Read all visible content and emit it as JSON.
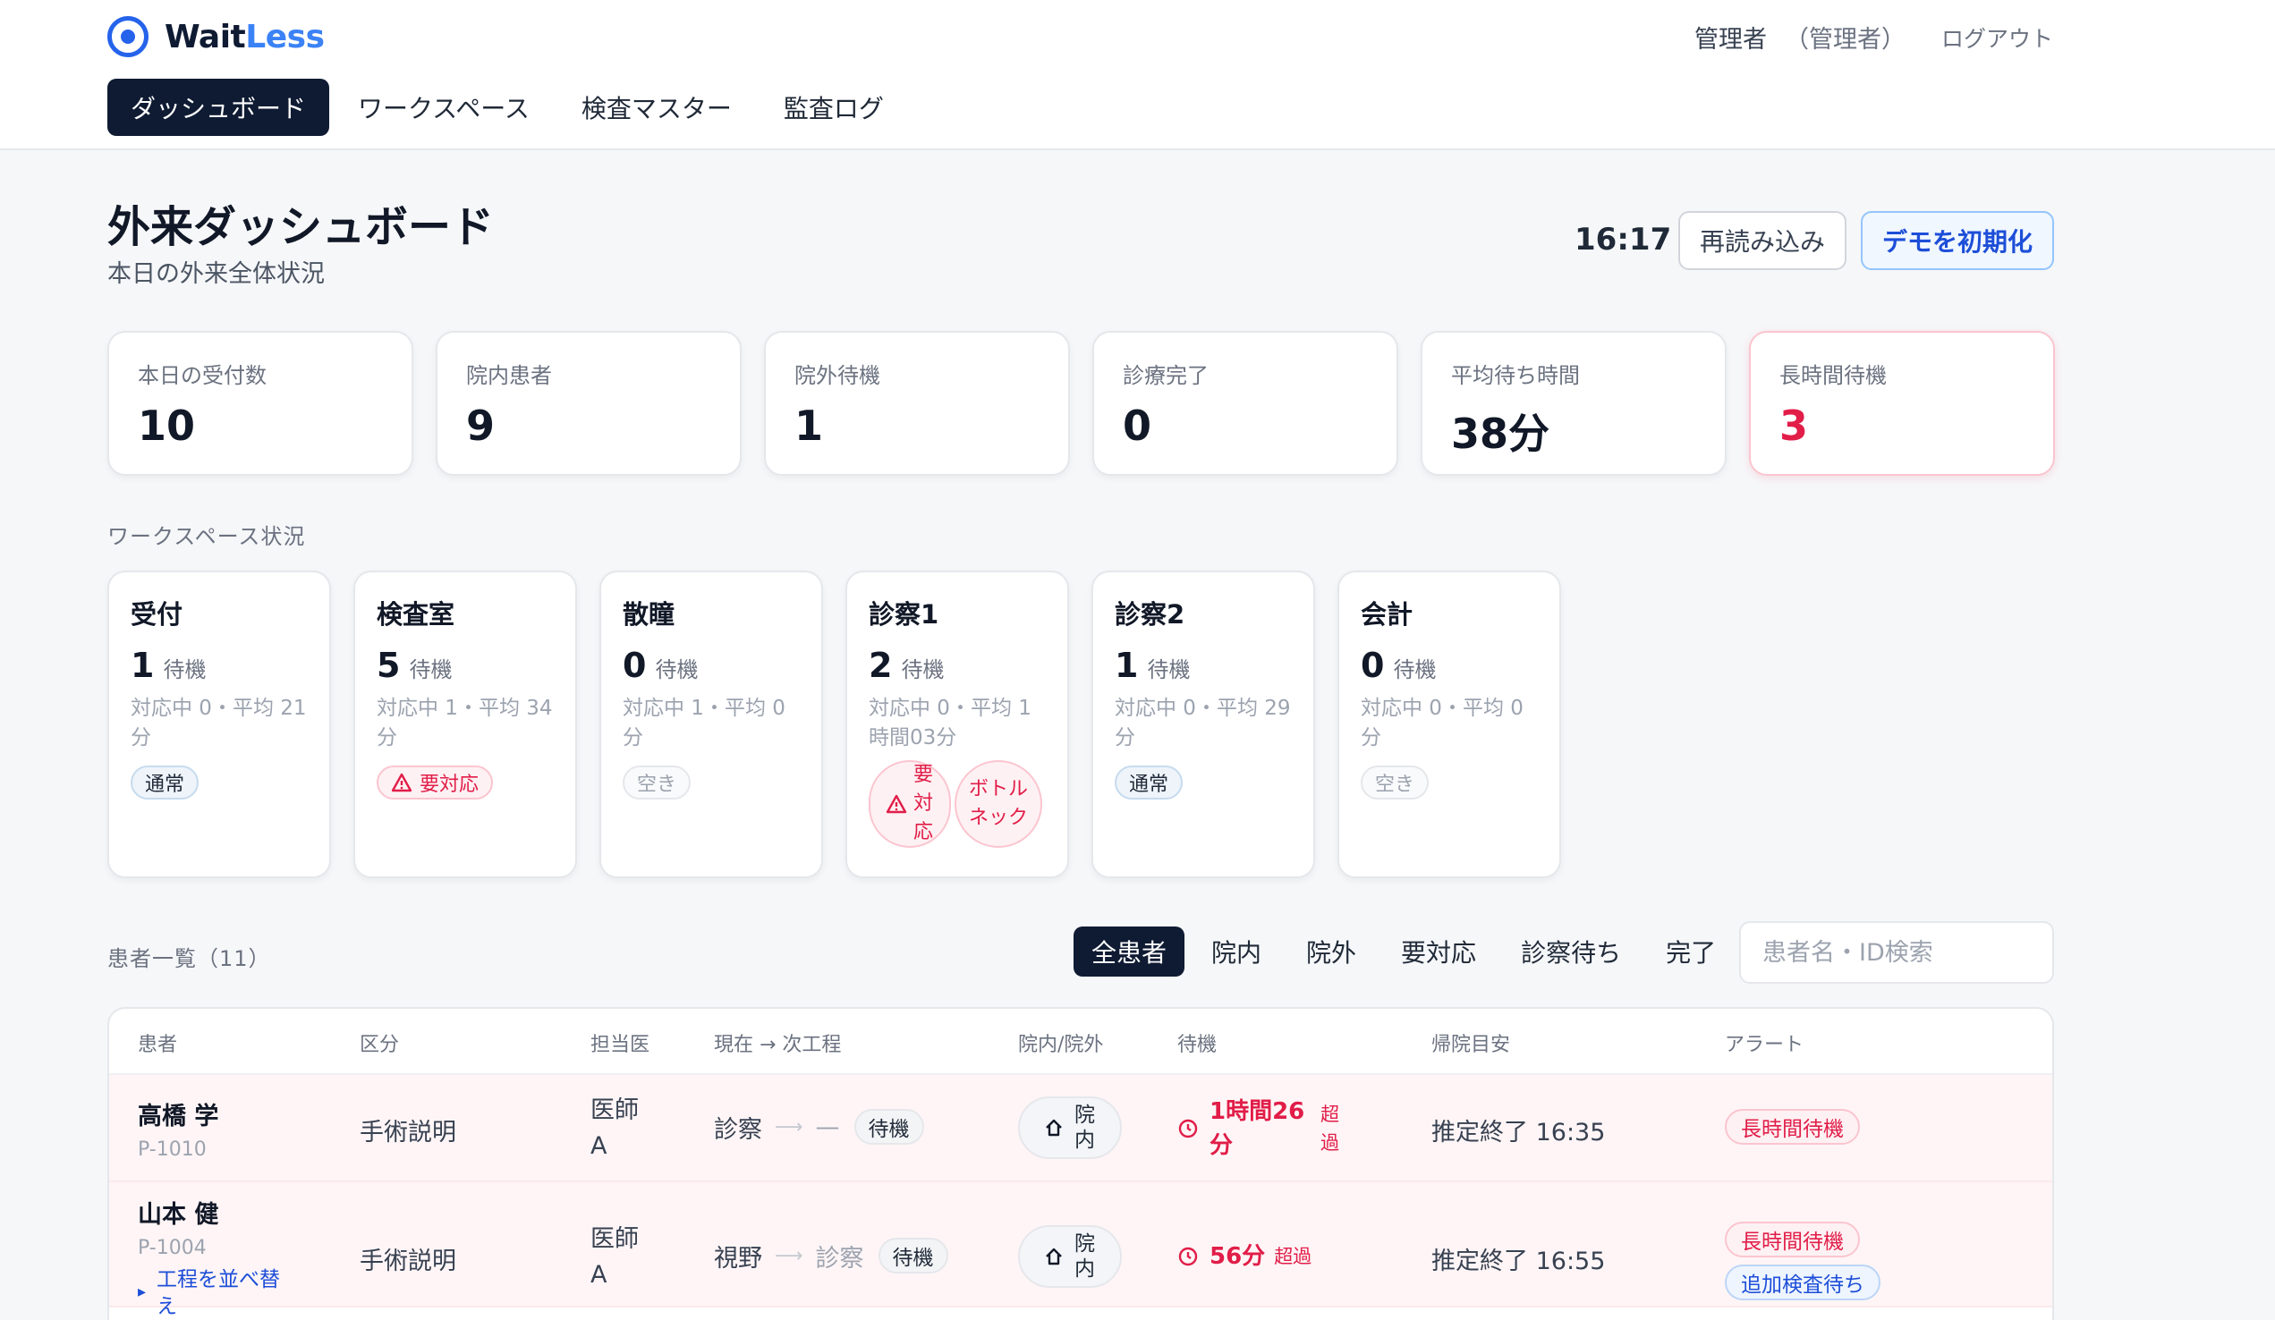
{
  "app": {
    "logo_a": "Wait",
    "logo_b": "Less"
  },
  "user": {
    "name": "管理者",
    "role": "（管理者）",
    "logout": "ログアウト"
  },
  "nav": [
    "ダッシュボード",
    "ワークスペース",
    "検査マスター",
    "監査ログ"
  ],
  "page": {
    "title": "外来ダッシュボード",
    "subtitle": "本日の外来全体状況",
    "time": "16:17",
    "reload": "再読み込み",
    "reset_demo": "デモを初期化"
  },
  "stats": [
    {
      "label": "本日の受付数",
      "value": "10"
    },
    {
      "label": "院内患者",
      "value": "9"
    },
    {
      "label": "院外待機",
      "value": "1"
    },
    {
      "label": "診療完了",
      "value": "0"
    },
    {
      "label": "平均待ち時間",
      "value": "38分"
    },
    {
      "label": "長時間待機",
      "value": "3"
    }
  ],
  "workspace_section": "ワークスペース状況",
  "workspaces": [
    {
      "name": "受付",
      "count": "1",
      "unit": "待機",
      "sub": "対応中 0・平均 21 分",
      "badges": [
        "通常"
      ]
    },
    {
      "name": "検査室",
      "count": "5",
      "unit": "待機",
      "sub": "対応中 1・平均 34 分",
      "badges": [
        "要対応"
      ]
    },
    {
      "name": "散瞳",
      "count": "0",
      "unit": "待機",
      "sub": "対応中 1・平均 0 分",
      "badges": [
        "空き"
      ]
    },
    {
      "name": "診察1",
      "count": "2",
      "unit": "待機",
      "sub": "対応中 0・平均 1 時間03分",
      "badges": [
        "要対応",
        "ボトルネック"
      ]
    },
    {
      "name": "診察2",
      "count": "1",
      "unit": "待機",
      "sub": "対応中 0・平均 29 分",
      "badges": [
        "通常"
      ]
    },
    {
      "name": "会計",
      "count": "0",
      "unit": "待機",
      "sub": "対応中 0・平均 0 分",
      "badges": [
        "空き"
      ]
    }
  ],
  "patients_section": "患者一覧（11）",
  "filters": [
    "全患者",
    "院内",
    "院外",
    "要対応",
    "診察待ち",
    "完了"
  ],
  "search": {
    "placeholder": "患者名・ID検索"
  },
  "table": {
    "headers": [
      "患者",
      "区分",
      "担当医",
      "現在 → 次工程",
      "院内/院外",
      "待機",
      "帰院目安",
      "アラート"
    ],
    "rows": [
      {
        "name": "高橋 学",
        "id": "P-1010",
        "type": "手術説明",
        "doctor": "医師 A",
        "current": "診察",
        "next": "—",
        "status": "待機",
        "location": "院内",
        "wait": "1時間26分",
        "over": "超過",
        "eta": "推定終了 16:35",
        "alerts": [
          "長時間待機"
        ],
        "reorder": ""
      },
      {
        "name": "山本 健",
        "id": "P-1004",
        "type": "手術説明",
        "doctor": "医師 A",
        "current": "視野",
        "next": "診察",
        "status": "待機",
        "location": "院内",
        "wait": "56分",
        "over": "超過",
        "eta": "推定終了 16:55",
        "alerts": [
          "長時間待機",
          "追加検査待ち"
        ],
        "reorder": "工程を並べ替え"
      }
    ]
  },
  "colors": {
    "navy": "#0f1b33",
    "accent": "#2563eb",
    "danger": "#e11d48"
  }
}
